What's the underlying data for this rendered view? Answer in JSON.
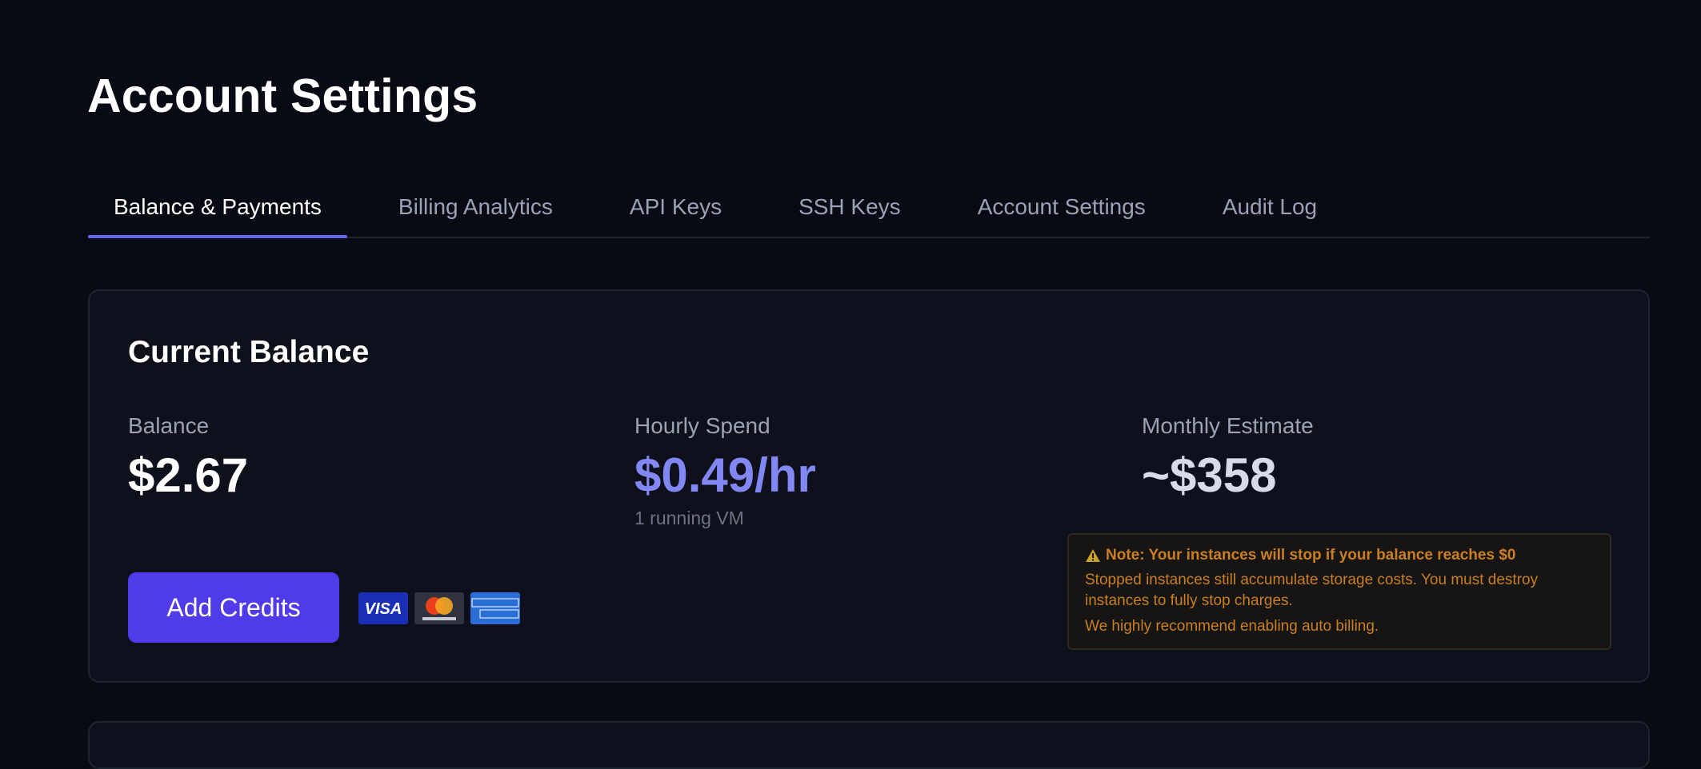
{
  "page": {
    "title": "Account Settings"
  },
  "tabs": [
    {
      "label": "Balance & Payments",
      "active": true
    },
    {
      "label": "Billing Analytics",
      "active": false
    },
    {
      "label": "API Keys",
      "active": false
    },
    {
      "label": "SSH Keys",
      "active": false
    },
    {
      "label": "Account Settings",
      "active": false
    },
    {
      "label": "Audit Log",
      "active": false
    }
  ],
  "balance_card": {
    "title": "Current Balance",
    "stats": {
      "balance": {
        "label": "Balance",
        "value": "$2.67"
      },
      "hourly": {
        "label": "Hourly Spend",
        "value": "$0.49/hr",
        "sub": "1 running VM"
      },
      "monthly": {
        "label": "Monthly Estimate",
        "value": "~$358"
      }
    },
    "add_credits_label": "Add Credits",
    "payment_icons": [
      "visa-icon",
      "mastercard-icon",
      "american-express-icon"
    ],
    "notice": {
      "title": "Note: Your instances will stop if your balance reaches $0",
      "body": "Stopped instances still accumulate storage costs. You must destroy instances to fully stop charges.",
      "recommendation": "We highly recommend enabling auto billing."
    }
  },
  "colors": {
    "background": "#080b13",
    "card": "#0e111c",
    "accent": "#6366f1",
    "primary_button": "#4f3bea",
    "hourly_value": "#8188f4",
    "monthly_value": "#d6dbe6",
    "warning": "#c97f22"
  }
}
